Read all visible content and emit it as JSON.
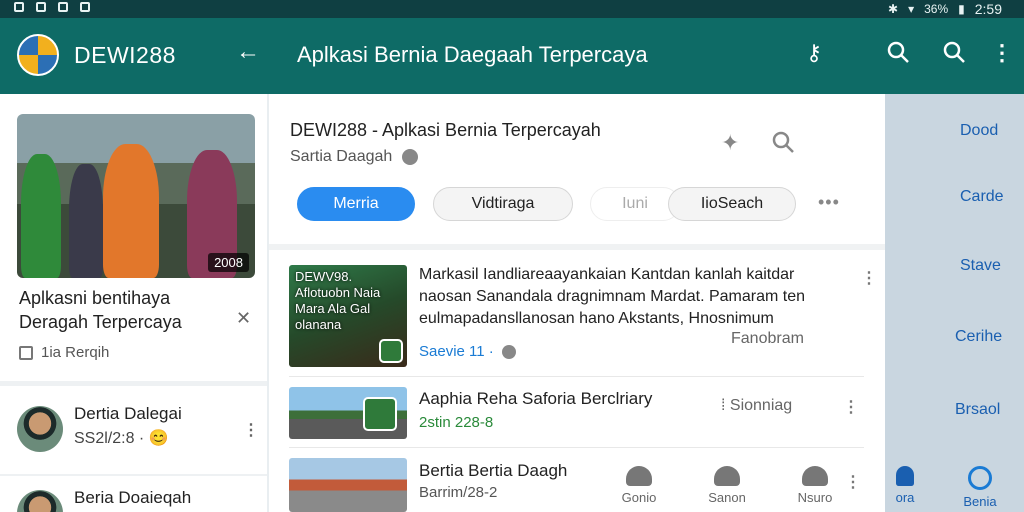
{
  "status_bar": {
    "battery": "36%",
    "time": "2:59"
  },
  "app_bar": {
    "brand": "DEWI288",
    "back_icon": "arrow-left-icon",
    "title": "Aplkasi Bernia Daegaah Terpercaya",
    "icons": [
      "key-icon",
      "search-icon",
      "search-icon",
      "more-vert-icon"
    ]
  },
  "left_panel": {
    "feature_card": {
      "badge": "2008",
      "title": "Aplkasni bentihaya Deragah Terpercaya",
      "meta": "1ia Rerqih"
    },
    "contacts": [
      {
        "name": "Dertia Dalegai",
        "sub": "SS2l/2:8 ·"
      },
      {
        "name": "Beria Doaieqah",
        "sub": ""
      }
    ]
  },
  "middle_panel": {
    "header": {
      "title": "DEWI288 - Aplkasi Bernia Terpercayah",
      "subtitle": "Sartia Daagah"
    },
    "chips": [
      "Merria",
      "Vidtiraga",
      "Iuni",
      "IioSeach"
    ],
    "items": [
      {
        "thumb_text": "DEWV98. Aflotuobn Naia Mara Ala Gal olanana",
        "desc": "Markasil Iandliareaayankaian Kantdan kanlah kaitdar naosan Sanandala dragnimnam Mardat. Pamaram ten eulmapadansllanosan hano Akstants, Hnosnimum",
        "right_text": "Fanobram",
        "sub": "Saevie 11 ·"
      },
      {
        "title": "Aaphia Reha Saforia Berclriary",
        "right_text": "Sionniag",
        "sub": "2stin 228-8"
      },
      {
        "title": "Bertia Bertia Daagh",
        "sub": "Barrim/28-2"
      }
    ],
    "bottom_nav": [
      "Gonio",
      "Sanon",
      "Nsuro"
    ]
  },
  "right_panel": {
    "items": [
      "Dood",
      "Carde",
      "Stave",
      "Cerihe",
      "Brsaol"
    ],
    "bottom_items": [
      "ora",
      "Benia"
    ]
  }
}
